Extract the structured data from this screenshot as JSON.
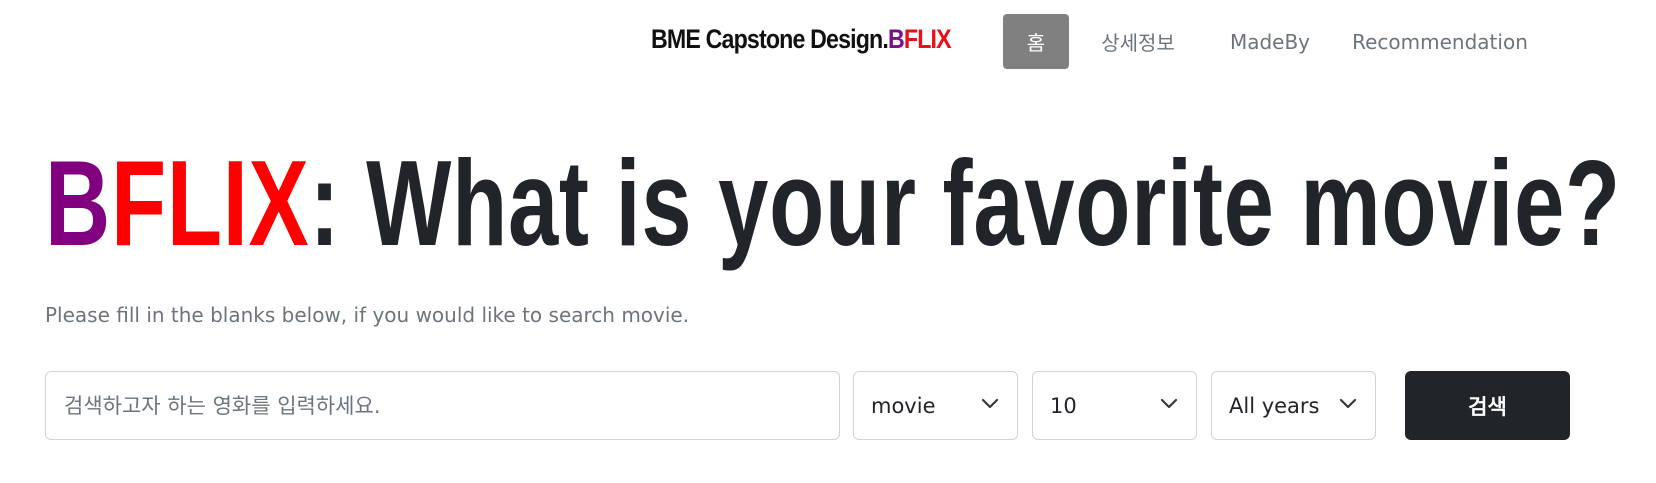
{
  "navbar": {
    "brand_prefix": "BME Capstone Design.",
    "brand_b": "B",
    "brand_flix": "FLIX",
    "items": [
      {
        "label": "홈",
        "active": true
      },
      {
        "label": "상세정보",
        "active": false
      },
      {
        "label": "MadeBy",
        "active": false
      },
      {
        "label": "Recommendation",
        "active": false
      }
    ]
  },
  "hero": {
    "b": "B",
    "flix": "FLIX",
    "rest": ": What is your favorite movie?"
  },
  "subtitle": "Please fill in the blanks below, if you would like to search movie.",
  "search": {
    "placeholder": "검색하고자 하는 영화를 입력하세요.",
    "value": "",
    "type_select": "movie",
    "count_select": "10",
    "year_select": "All years",
    "button_label": "검색"
  },
  "colors": {
    "brand_purple": "#800080",
    "brand_red": "#ff0000",
    "active_nav_bg": "#808080",
    "button_bg": "#212529"
  },
  "icons": {
    "select_chevron": "chevron-down-icon"
  }
}
